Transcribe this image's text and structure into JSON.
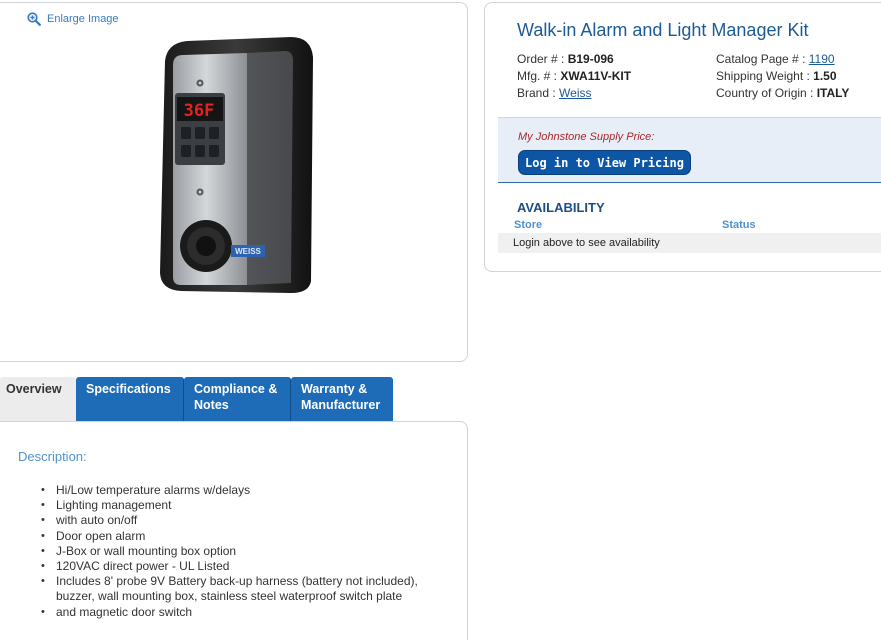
{
  "image_panel": {
    "enlarge_label": "Enlarge Image",
    "device_display": "36F",
    "device_brand": "WEISS"
  },
  "product": {
    "title": "Walk-in Alarm and Light Manager Kit",
    "order_label": "Order # : ",
    "order_value": "B19-096",
    "mfg_label": "Mfg. # : ",
    "mfg_value": "XWA11V-KIT",
    "brand_label": "Brand : ",
    "brand_value": "Weiss",
    "catalog_label": "Catalog Page # : ",
    "catalog_value": "1190",
    "weight_label": "Shipping Weight : ",
    "weight_value": "1.50",
    "origin_label": "Country of Origin : ",
    "origin_value": "ITALY"
  },
  "pricing": {
    "label": "My Johnstone Supply Price:",
    "login_button": "Log in to View Pricing"
  },
  "availability": {
    "title": "AVAILABILITY",
    "col_store": "Store",
    "col_status": "Status",
    "message": "Login above to see availability"
  },
  "tabs": [
    {
      "label": "Overview"
    },
    {
      "label": "Specifications"
    },
    {
      "label": "Compliance & Notes"
    },
    {
      "label": "Warranty & Manufacturer"
    }
  ],
  "description": {
    "title": "Description:",
    "items": [
      "Hi/Low temperature alarms w/delays",
      "Lighting management",
      "with auto on/off",
      "Door open alarm",
      "J-Box or wall mounting box option",
      "120VAC direct power - UL Listed",
      "Includes 8' probe 9V Battery back-up harness (battery not included), buzzer, wall mounting box, stainless steel waterproof switch plate",
      "and magnetic door switch"
    ]
  },
  "colors": {
    "tab_blue": "#1e6cb8",
    "link_blue": "#1c5a96",
    "price_red": "#a9272a",
    "button_blue": "#0d56a6"
  }
}
